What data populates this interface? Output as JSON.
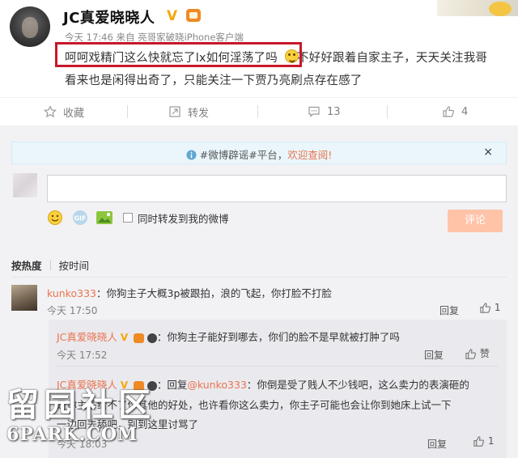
{
  "post": {
    "author": "JC真爱晓晓人",
    "verified_icon": "V",
    "meta": "今天 17:46 来自 亮哥家破晓iPhone客户端",
    "line1a": "呵呵戏精门这么快就忘了lx如何淫荡了吗",
    "line1b": "不好好跟着自家主子，天天关注我哥",
    "line2": "看来也是闲得出奇了，只能关注一下贾乃亮刷点存在感了"
  },
  "actions": {
    "favorite": "收藏",
    "repost": "转发",
    "comment_count": "13",
    "like_count": "4"
  },
  "notice": {
    "text_pre": "#微博辟谣#平台，",
    "text_link": "欢迎查阅!",
    "close": "×"
  },
  "compose": {
    "input_value": "",
    "also_repost": "同时转发到我的微博",
    "submit": "评论"
  },
  "sort": {
    "hot": "按热度",
    "time": "按时间"
  },
  "comments": [
    {
      "user": "kunko333",
      "text": "你狗主子大概3p被跟拍，浪的飞起，你打脸不打脸",
      "time": "今天 17:50",
      "reply_label": "回复",
      "likes": "1"
    }
  ],
  "replies": [
    {
      "user": "JC真爱晓晓人",
      "text": "你狗主子能好到哪去，你们的脸不是早就被打肿了吗",
      "time": "今天 17:52",
      "reply_label": "回复",
      "likes": "赞"
    },
    {
      "user": "JC真爱晓晓人",
      "prefix": "回复",
      "mention": "@kunko333",
      "line1": "你倒是受了贱人不少钱吧，这么卖力的表演砸的",
      "line2": "是你主子给不了你其他的好处，也许看你这么卖力，你主子可能也会让你到她床上试一下",
      "line3": "一边回去舔吧，别到这里讨骂了",
      "time": "今天 18:03",
      "reply_label": "回复",
      "likes": "1"
    }
  ],
  "watermark": {
    "line1": "留园社区",
    "line2": "6PARK.COM"
  },
  "colors": {
    "link": "#eb7350",
    "highlight_box": "#c8182a",
    "verified": "#f7a70a"
  }
}
